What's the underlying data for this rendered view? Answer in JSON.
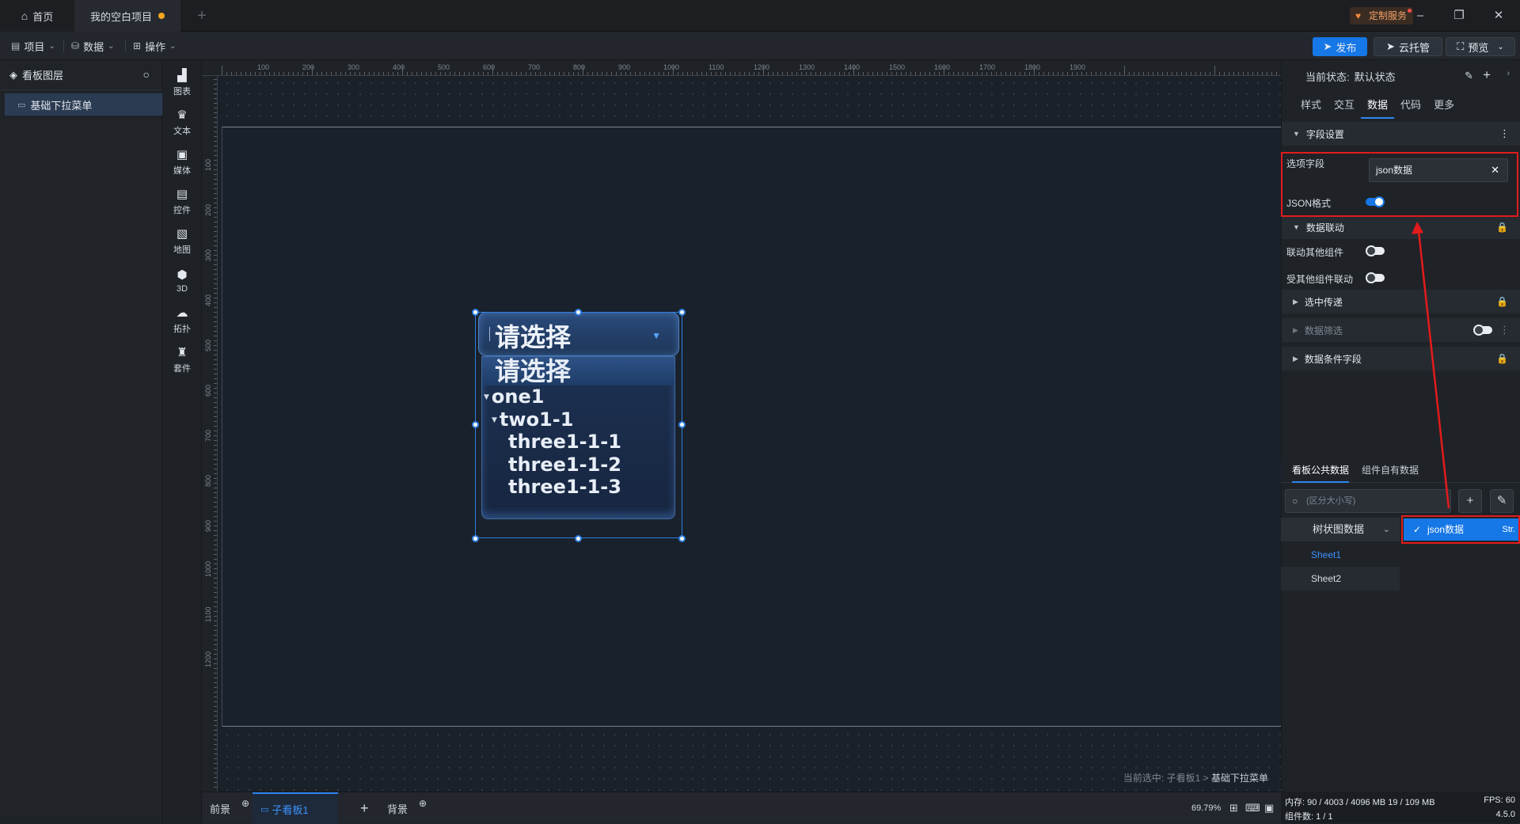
{
  "tabs": {
    "home": "首页",
    "project": "我的空白项目"
  },
  "window": {
    "custom_service": "定制服务"
  },
  "toolbar": {
    "menus": [
      "项目",
      "数据",
      "操作"
    ],
    "publish": "发布",
    "cloud": "云托管",
    "preview": "预览"
  },
  "layers": {
    "title": "看板图层",
    "item": "基础下拉菜单"
  },
  "components": [
    "图表",
    "文本",
    "媒体",
    "控件",
    "地图",
    "3D",
    "拓扑",
    "套件"
  ],
  "ruler": {
    "h_ticks": [
      "100",
      "200",
      "300",
      "400",
      "500",
      "600",
      "700",
      "800",
      "900",
      "1000",
      "1100",
      "1200",
      "1300",
      "1400",
      "1500",
      "1600",
      "1700",
      "1800",
      "1900"
    ],
    "v_ticks": [
      "100",
      "200",
      "300",
      "400",
      "500",
      "600",
      "700",
      "800",
      "900",
      "1000",
      "1100",
      "1200"
    ]
  },
  "dropdown": {
    "placeholder": "请选择",
    "options": [
      {
        "label": "请选择",
        "level": 0,
        "expander": false
      },
      {
        "label": "one1",
        "level": 0,
        "expander": true
      },
      {
        "label": "two1-1",
        "level": 1,
        "expander": true
      },
      {
        "label": "three1-1-1",
        "level": 2,
        "expander": false
      },
      {
        "label": "three1-1-2",
        "level": 2,
        "expander": false
      },
      {
        "label": "three1-1-3",
        "level": 2,
        "expander": false
      }
    ]
  },
  "canvas_status": {
    "prefix": "当前选中:",
    "path": "子看板1 >",
    "current": "基础下拉菜单"
  },
  "panel": {
    "state_label": "当前状态:",
    "state_value": "默认状态",
    "tabs": [
      "样式",
      "交互",
      "数据",
      "代码",
      "更多"
    ],
    "active_tab": "数据",
    "field_settings": "字段设置",
    "option_field_label": "选项字段",
    "option_field_value": "json数据",
    "json_format_label": "JSON格式",
    "json_format_on": true,
    "data_linkage": "数据联动",
    "link_other_label": "联动其他组件",
    "linked_by_other_label": "受其他组件联动",
    "select_pass": "选中传递",
    "data_filter": "数据筛选",
    "data_condition": "数据条件字段",
    "data_tabs": [
      "看板公共数据",
      "组件自有数据"
    ],
    "search_placeholder": "(区分大小写)",
    "tree_category": "树状图数据",
    "sheets": [
      "Sheet1",
      "Sheet2"
    ],
    "selected_source": "json数据",
    "selected_source_type": "Str."
  },
  "bottom": {
    "front": "前景",
    "board": "子看板1",
    "bg": "背景",
    "zoom": "69.79%"
  },
  "sys": {
    "memory": "内存: 90 / 4003 / 4096 MB  19 / 109 MB",
    "fps": "FPS: 60",
    "components": "组件数: 1 / 1",
    "version": "4.5.0"
  },
  "colors": {
    "accent": "#1677e6",
    "annotation_red": "#e31b1b",
    "modified_dot": "#f5a623"
  }
}
